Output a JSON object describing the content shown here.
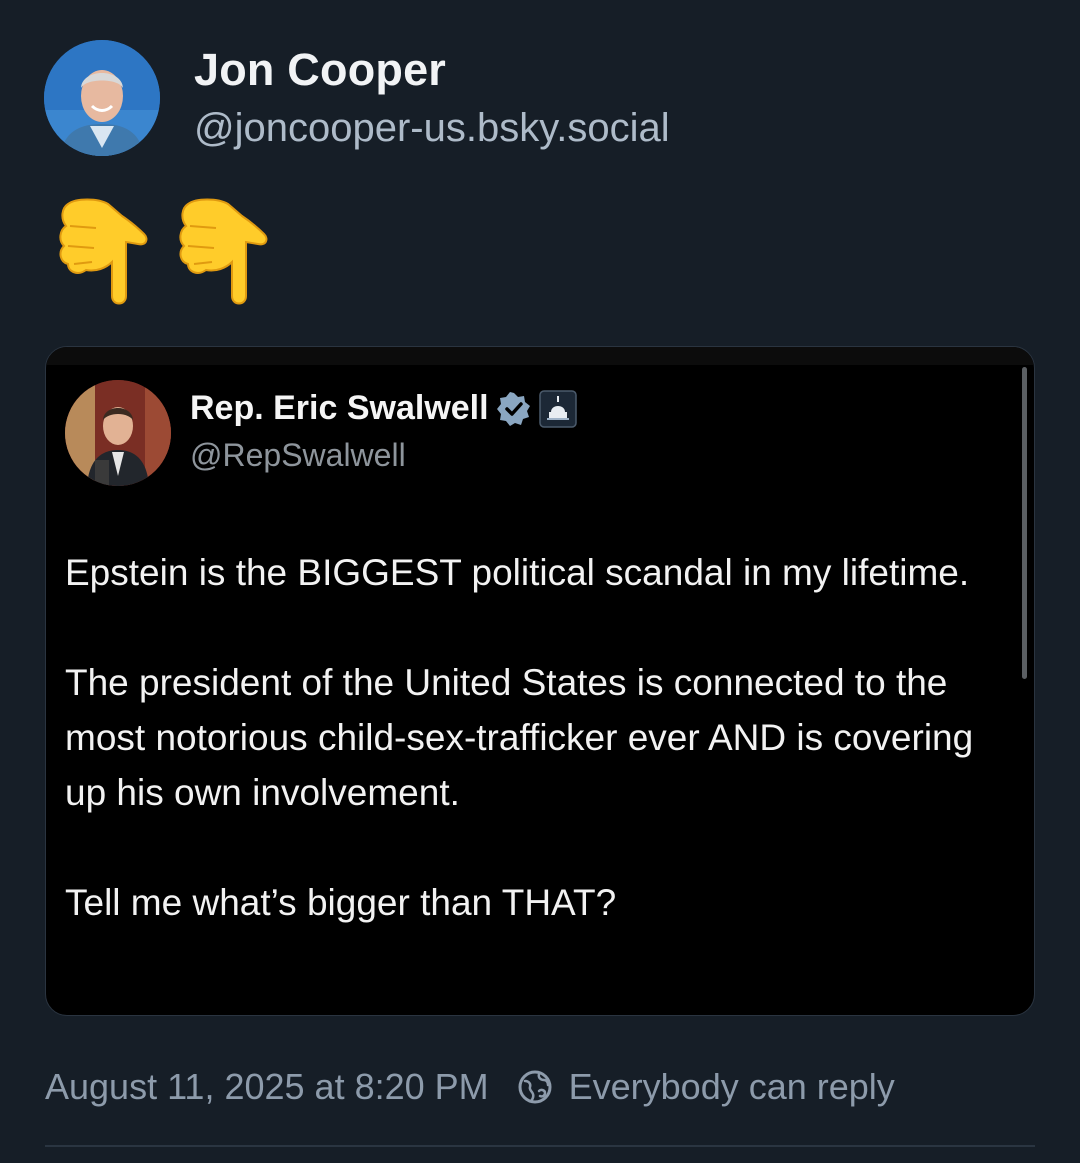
{
  "post": {
    "author": {
      "display_name": "Jon Cooper",
      "handle": "@joncooper-us.bsky.social"
    },
    "emoji": [
      "backhand-index-pointing-down",
      "backhand-index-pointing-down"
    ],
    "quoted_post": {
      "display_name": "Rep. Eric Swalwell",
      "handle": "@RepSwalwell",
      "paragraphs": [
        "Epstein is the BIGGEST political scandal in my lifetime.",
        "The president of the United States is connected to the most notorious child-sex-trafficker ever AND is covering up his own involvement.",
        "Tell me what’s bigger than THAT?"
      ]
    },
    "timestamp": "August 11, 2025 at 8:20 PM",
    "reply_setting": "Everybody can reply"
  },
  "colors": {
    "background": "#161e27",
    "quote_background": "#000000",
    "muted_text": "#8d9bab",
    "handle_text": "#aebbc9",
    "emoji_yellow": "#ffcc2a",
    "verified_badge": "#8aa6c1"
  }
}
